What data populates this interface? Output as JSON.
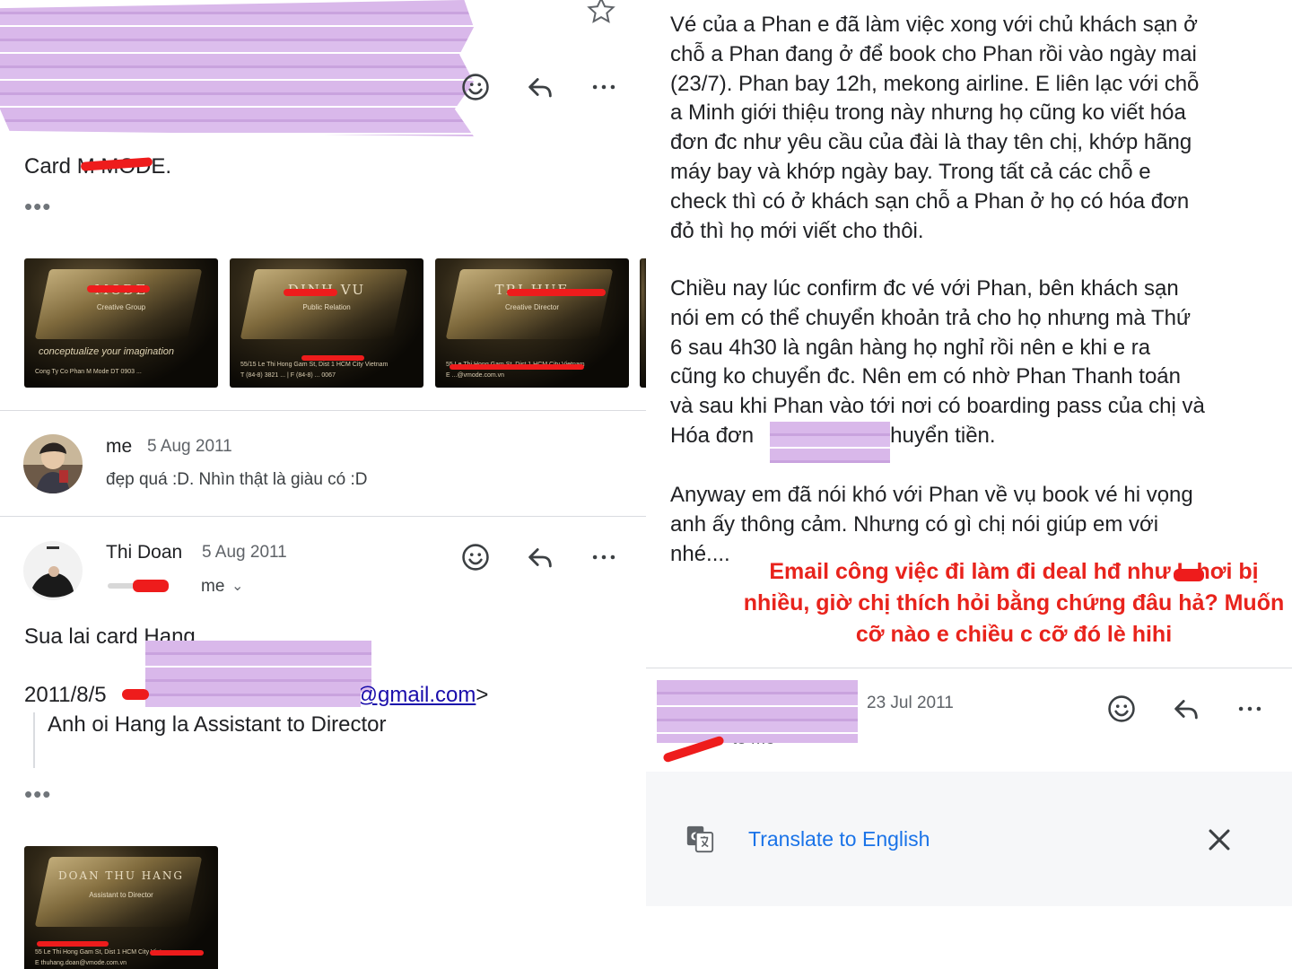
{
  "left": {
    "message1": {
      "body_text": "Card M MODE.",
      "more_dots": "•••",
      "cards": [
        {
          "title": "MODE",
          "subtitle": "Creative Group",
          "tagline": "conceptualize your imagination",
          "footer_line1": "Cong Ty Co Phan M Mode  DT 0903 ...",
          "footer_line2": ""
        },
        {
          "title": "DINH VU",
          "subtitle": "Public Relation",
          "tagline": "",
          "footer_line1": "55/15 Le Thi Hong Gam St, Dist 1 HCM City Vietnam",
          "footer_line2": "T (84-8) 3821 ... | F (84-8) ... 0067"
        },
        {
          "title": "TRI HUE",
          "subtitle": "Creative Director",
          "tagline": "",
          "footer_line1": "55 Le Thi Hong Gam St, Dist 1 HCM City Vietnam",
          "footer_line2": "E ...@vmode.com.vn"
        }
      ]
    },
    "message2": {
      "sender": "me",
      "date": "5 Aug 2011",
      "snippet": "đẹp quá :D. Nhìn thật là giàu có :D"
    },
    "message3": {
      "sender": "Thi Doan",
      "date": "5 Aug 2011",
      "recipient": "me",
      "body_line1": "Sua lai card Hang.",
      "quote_date": "2011/8/5",
      "quote_email_domain": "@gmail.com",
      "quote_email_close": ">",
      "quote_text": "Anh oi Hang la Assistant to Director",
      "more_dots": "•••",
      "card": {
        "title": "DOAN THU HANG",
        "subtitle": "Assistant to Director",
        "footer_line1": "55 Le Thi Hong Gam St, Dist 1 HCM City Vietnam",
        "footer_line2": "E thuhang.doan@vmode.com.vn"
      }
    }
  },
  "right": {
    "paragraph1": [
      "Vé của a Phan e đã làm việc xong với chủ khách sạn ở",
      "chỗ a Phan đang ở để book cho Phan rồi vào ngày mai",
      "(23/7). Phan bay 12h, mekong airline. E liên lạc với chỗ",
      "a Minh giới thiệu trong này nhưng họ cũng ko viết hóa",
      "đơn đc như yêu cầu của đài là thay tên chị, khớp hãng",
      "máy bay và khớp ngày bay. Trong tất cả các chỗ e",
      "check thì có ở khách sạn chỗ a Phan ở họ có hóa đơn",
      "đỏ thì họ mới viết cho thôi."
    ],
    "paragraph2": [
      "Chiều nay lúc confirm đc vé với Phan, bên khách sạn",
      "nói em có thể chuyển khoản trả cho họ nhưng mà Thứ",
      "6 sau 4h30 là ngân hàng họ nghỉ rồi nên e khi e ra",
      "cũng ko chuyển đc. Nên em có nhờ Phan Thanh toán",
      "và sau khi Phan vào tới nơi có boarding pass của chị và"
    ],
    "paragraph2_last_prefix": "Hóa đơn",
    "paragraph2_last_suffix": "chuyển tiền.",
    "paragraph3": [
      "Anyway em đã nói khó với Phan về vụ book vé hi vọng",
      "anh ấy thông cảm. Nhưng có gì chị nói giúp em với",
      "nhé...."
    ],
    "caption": [
      "Email công việc đi làm đi deal hđ  như L  hơi bị",
      "nhiều, giờ chị thích hỏi bằng chứng đâu hả? Muốn",
      "cỡ nào e chiều c cỡ đó lè hihi"
    ],
    "message_header": {
      "date": "23 Jul 2011",
      "recipient": "to me"
    },
    "translate_label": "Translate to English",
    "colors": {
      "accent": "#1a73e8",
      "caption": "#e8231c",
      "redaction": "#d9b8ea"
    }
  },
  "icons": {
    "star": "star-icon",
    "emoji": "emoji-icon",
    "reply": "reply-icon",
    "more": "more-icon",
    "translate": "translate-icon",
    "close": "close-icon"
  }
}
